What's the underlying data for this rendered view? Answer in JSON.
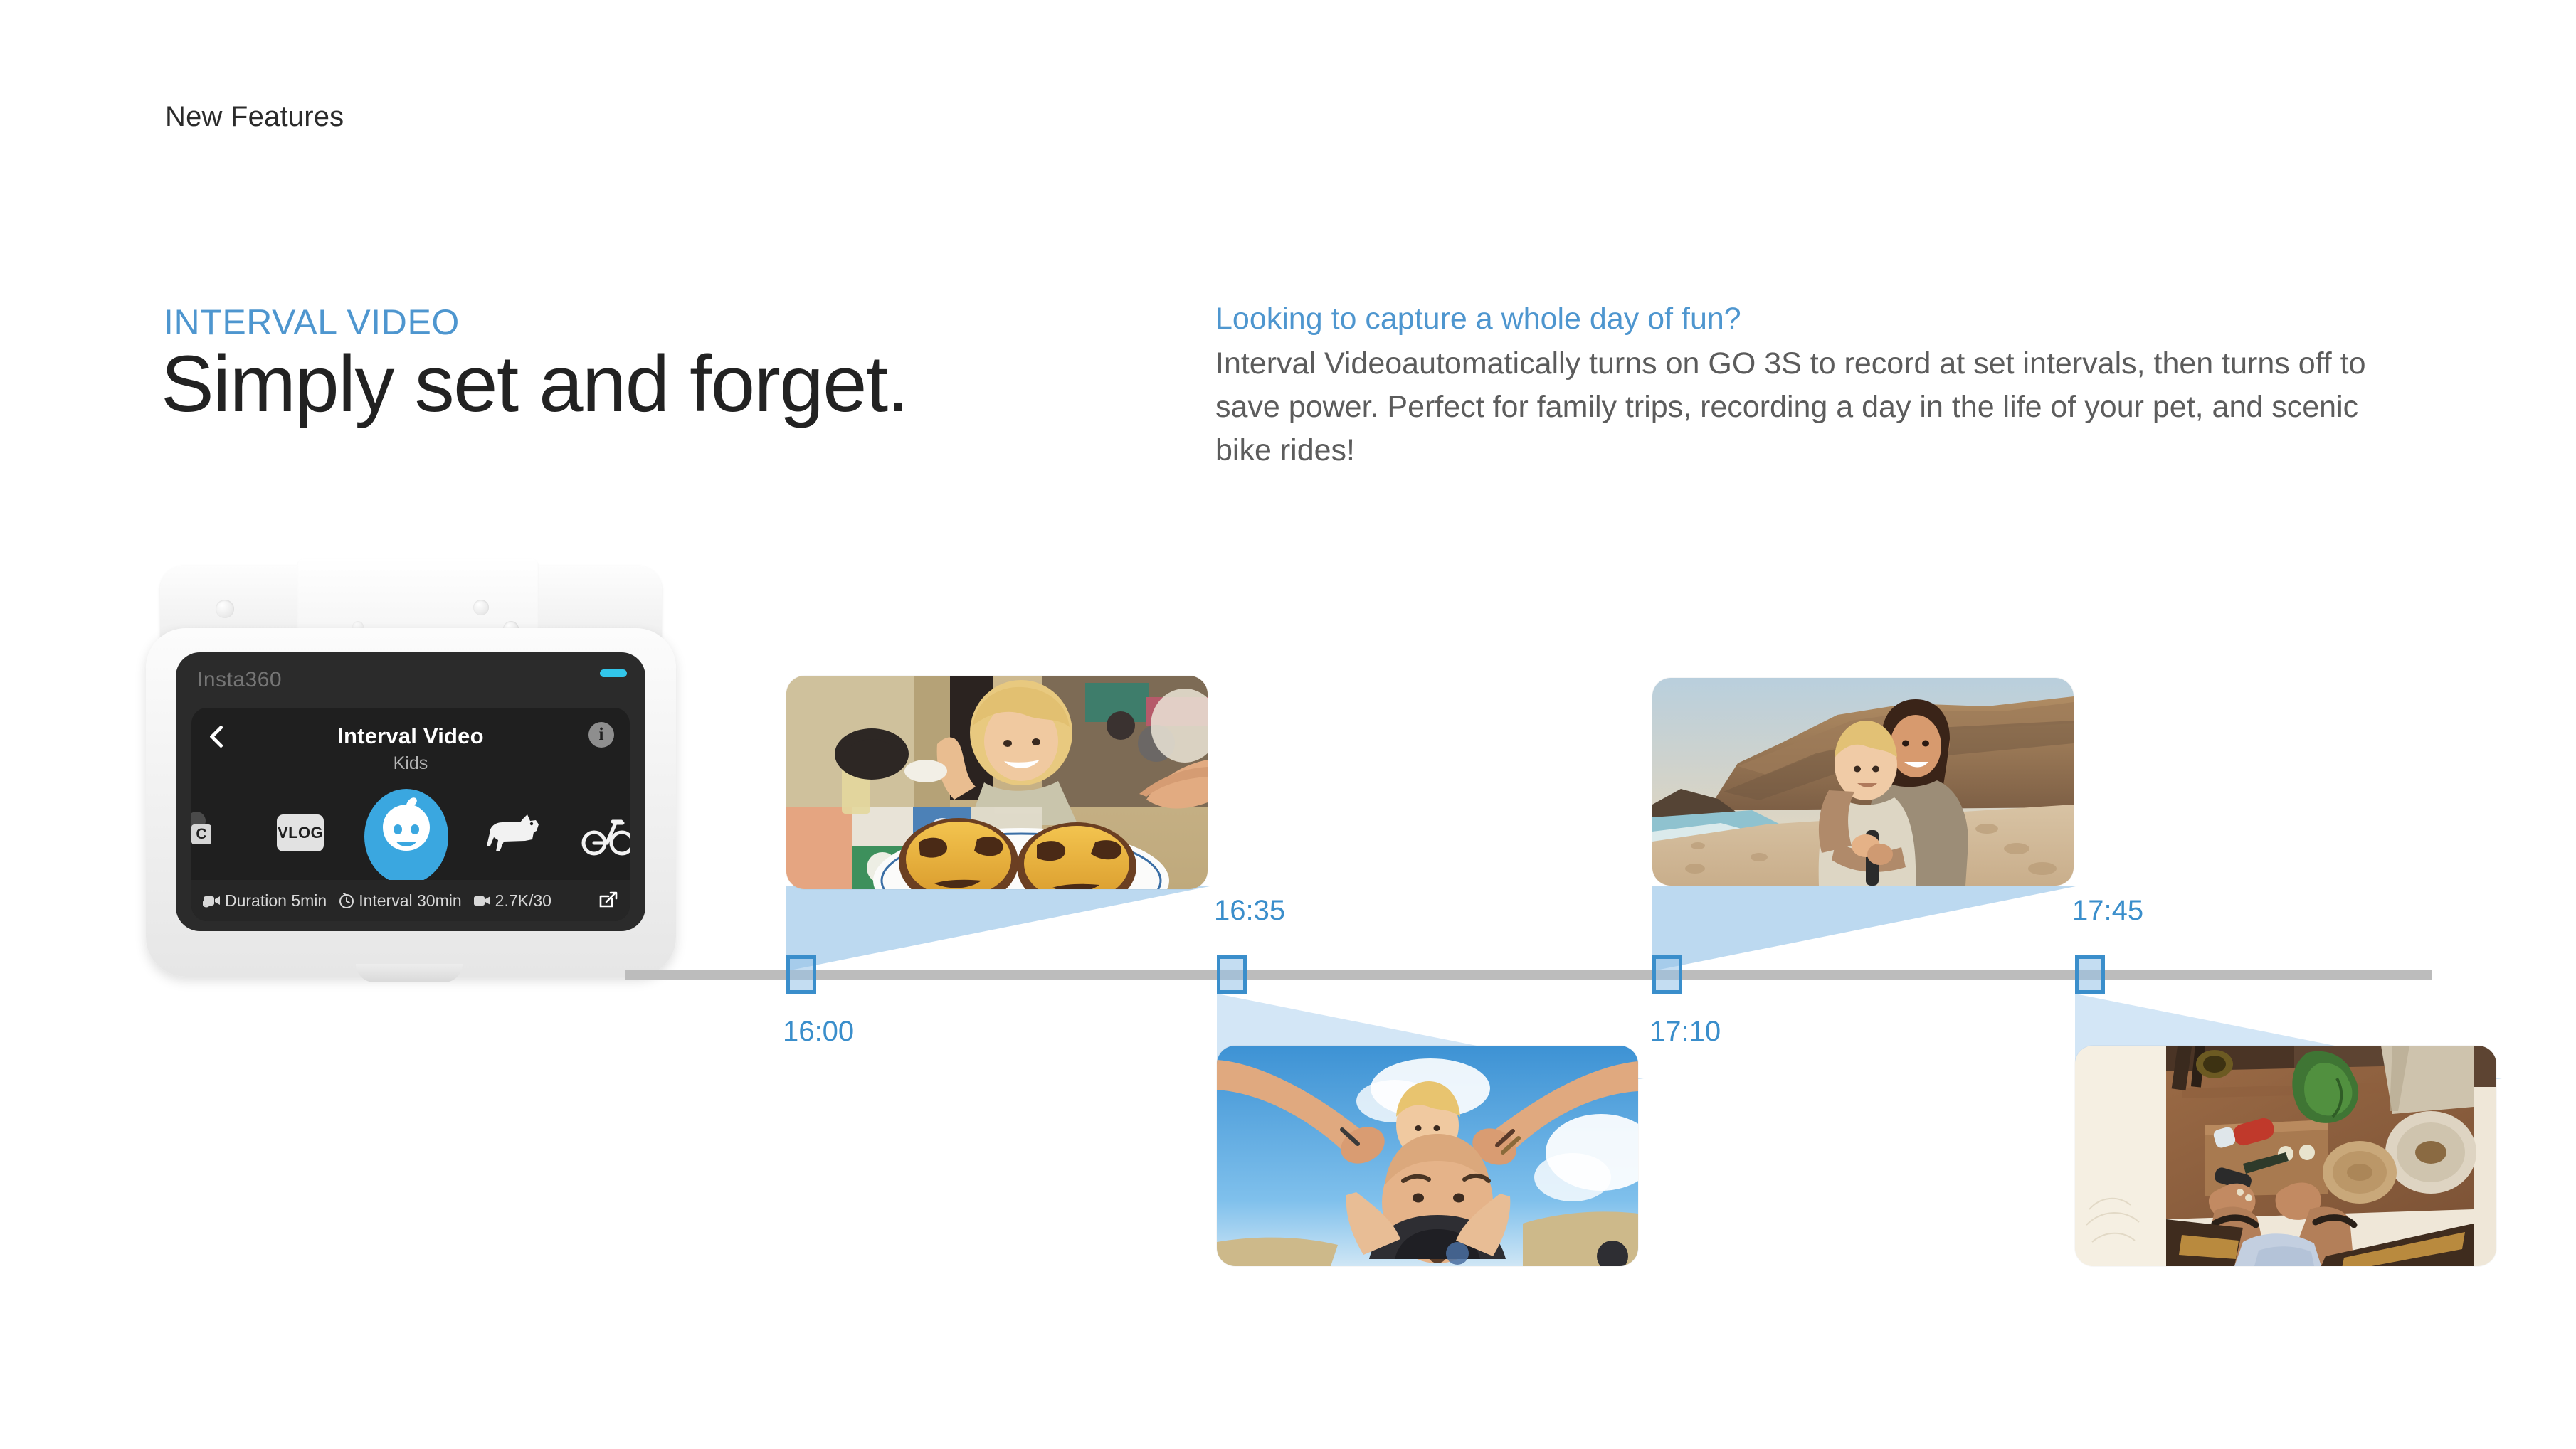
{
  "page": {
    "kicker": "New Features"
  },
  "hero": {
    "eyebrow": "INTERVAL VIDEO",
    "headline": "Simply set and forget.",
    "accent_color": "#4e96cf"
  },
  "copy": {
    "lead": "Looking to capture a whole day of fun?",
    "body": "Interval Videoautomatically turns on GO 3S to record at set intervals, then turns off to save power. Perfect for family trips, recording a day in the life of your pet, and scenic bike rides!"
  },
  "camera": {
    "brand": "Insta360",
    "led_color": "#32c6ea",
    "screen": {
      "title": "Interval Video",
      "subtitle": "Kids",
      "back_icon": "chevron-left-icon",
      "info_icon": "info-icon",
      "modes": [
        {
          "id": "mode-c",
          "label": "C",
          "selected": false
        },
        {
          "id": "mode-vlog",
          "label": "VLOG",
          "selected": false
        },
        {
          "id": "mode-kids",
          "label": "Kids",
          "selected": true
        },
        {
          "id": "mode-dog",
          "label": "Pet",
          "selected": false
        },
        {
          "id": "mode-bike",
          "label": "Bike",
          "selected": false
        }
      ],
      "selected_color": "#3aa7e0",
      "status": [
        {
          "icon": "duration-icon",
          "label": "Duration 5min"
        },
        {
          "icon": "interval-clock-icon",
          "label": "Interval 30min"
        },
        {
          "icon": "video-quality-icon",
          "label": "2.7K/30"
        }
      ],
      "edit_icon": "edit-square-icon"
    }
  },
  "timeline": {
    "line_color": "#bcbcbc",
    "marker_color": "#3a8ecb",
    "marker_fill": "rgba(147,193,232,.55)",
    "events": [
      {
        "time": "16:00",
        "label_position": "below",
        "thumb_position": "above",
        "scene": "child-smiling-with-pastries"
      },
      {
        "time": "16:35",
        "label_position": "above",
        "thumb_position": "below",
        "scene": "child-on-shoulders-blue-sky"
      },
      {
        "time": "17:10",
        "label_position": "below",
        "thumb_position": "above",
        "scene": "mother-and-child-beach-sunset"
      },
      {
        "time": "17:45",
        "label_position": "above",
        "thumb_position": "below",
        "scene": "overhead-kitchen-chopping"
      }
    ]
  }
}
